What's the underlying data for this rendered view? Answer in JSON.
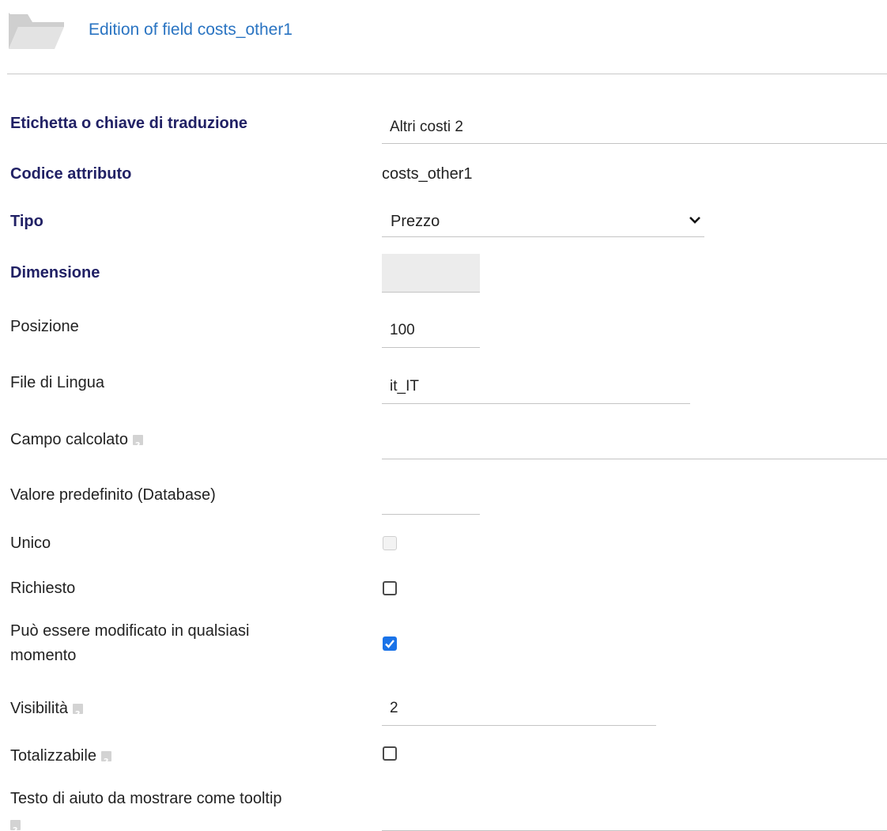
{
  "header": {
    "title": "Edition of field costs_other1",
    "icon": "folder-icon"
  },
  "fields": {
    "label_key": {
      "label": "Etichetta o chiave di traduzione",
      "value": "Altri costi 2"
    },
    "attribute_code": {
      "label": "Codice attributo",
      "value": "costs_other1"
    },
    "type": {
      "label": "Tipo",
      "value": "Prezzo"
    },
    "dimension": {
      "label": "Dimensione",
      "value": ""
    },
    "position": {
      "label": "Posizione",
      "value": "100"
    },
    "language_file": {
      "label": "File di Lingua",
      "value": "it_IT"
    },
    "computed_field": {
      "label": "Campo calcolato",
      "value": ""
    },
    "default_value": {
      "label": "Valore predefinito (Database)",
      "value": ""
    },
    "unique": {
      "label": "Unico",
      "checked": false,
      "disabled": true
    },
    "required": {
      "label": "Richiesto",
      "checked": false
    },
    "always_editable": {
      "label_line1": "Può essere modificato in qualsiasi",
      "label_line2": "momento",
      "checked": true
    },
    "visibility": {
      "label": "Visibilità",
      "value": "2"
    },
    "totalizable": {
      "label": "Totalizzabile",
      "checked": false
    },
    "help_text": {
      "label": "Testo di aiuto da mostrare come tooltip",
      "value": ""
    }
  },
  "colors": {
    "title": "#2a74c2",
    "bold_label": "#212165",
    "checkbox_checked": "#1a73e8"
  }
}
